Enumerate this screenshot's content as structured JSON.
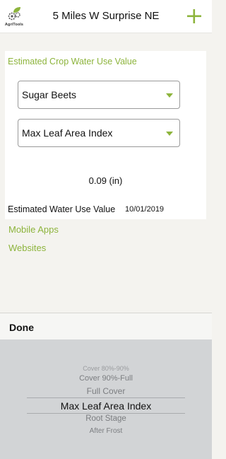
{
  "header": {
    "logo_text": "AgriTools",
    "title": "5 Miles W Surprise NE",
    "add_icon": "plus-icon",
    "accent": "#8db43c"
  },
  "card": {
    "section_title": "Estimated Crop Water Use Value",
    "crop_select": {
      "value": "Sugar Beets",
      "icon": "chevron-down-icon"
    },
    "stage_select": {
      "value": "Max Leaf Area Index",
      "icon": "chevron-down-icon"
    },
    "result": "0.09 (in)",
    "estimate_label": "Estimated Water Use Value",
    "estimate_date": "10/01/2019"
  },
  "links": [
    "Mobile Apps",
    "Websites"
  ],
  "picker": {
    "done_label": "Done",
    "options": [
      "Cover 80%-90%",
      "Cover 90%-Full",
      "Full Cover",
      "Max Leaf Area Index",
      "Root Stage",
      "After Frost"
    ],
    "selected": "Max Leaf Area Index"
  }
}
